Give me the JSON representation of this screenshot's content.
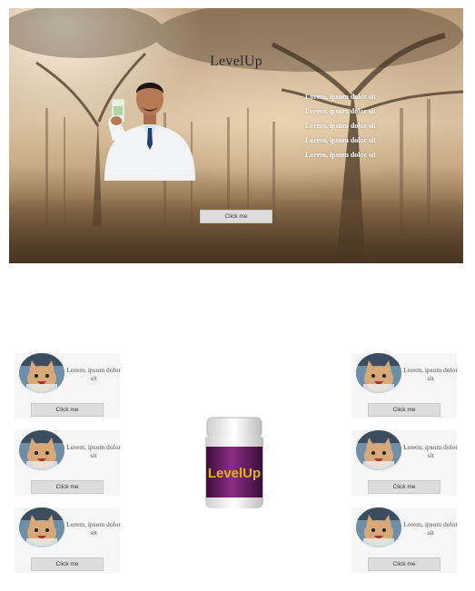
{
  "hero": {
    "title": "LevelUp",
    "features": [
      "Lorem, ipsum dolor sit",
      "Lorem, ipsum dolor sit",
      "Lorem, ipsum dolor sit",
      "Lorem, ipsum dolor sit",
      "Lorem, ipsum dolor sit"
    ],
    "button_label": "Click me"
  },
  "left_cards": [
    {
      "text": "Lorem, ipsum dolor sit",
      "button_label": "Click me"
    },
    {
      "text": "Lorem, ipsum dolor sit",
      "button_label": "Click me"
    },
    {
      "text": "Lorem, ipsum dolor sit",
      "button_label": "Click me"
    }
  ],
  "right_cards": [
    {
      "text": "Lorem, ipsum dolor sit",
      "button_label": "Click me"
    },
    {
      "text": "Lorem, ipsum dolor sit",
      "button_label": "Click me"
    },
    {
      "text": "Lorem, ipsum dolor sit",
      "button_label": "Click me"
    }
  ],
  "product": {
    "label": "LevelUp",
    "label_color": "#e0b21e",
    "body_color": "#6e1f6a"
  }
}
